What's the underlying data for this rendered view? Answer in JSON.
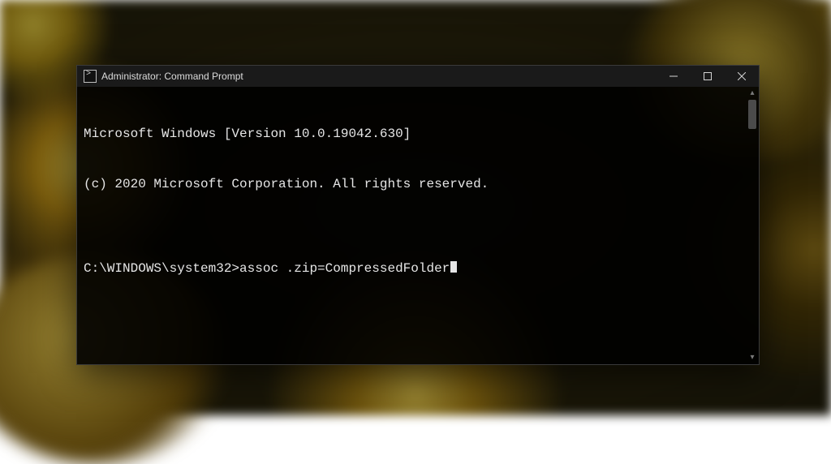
{
  "titlebar": {
    "title": "Administrator: Command Prompt"
  },
  "terminal": {
    "banner_line1": "Microsoft Windows [Version 10.0.19042.630]",
    "banner_line2": "(c) 2020 Microsoft Corporation. All rights reserved.",
    "blank": "",
    "prompt_prefix": "C:\\WINDOWS\\system32>",
    "command": "assoc .zip=CompressedFolder"
  }
}
